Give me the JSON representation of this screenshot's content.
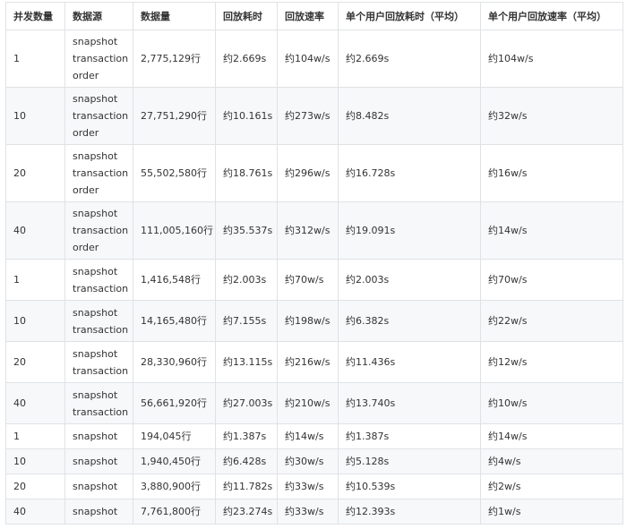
{
  "table": {
    "headers": [
      "并发数量",
      "数据源",
      "数据量",
      "回放耗时",
      "回放速率",
      "单个用户回放耗时（平均）",
      "单个用户回放速率（平均）"
    ],
    "rows": [
      {
        "concurrency": "1",
        "source": [
          "snapshot",
          "transaction",
          "order"
        ],
        "volume": "2,775,129行",
        "time": "约2.669s",
        "rate": "约104w/s",
        "user_time": "约2.669s",
        "user_rate": "约104w/s"
      },
      {
        "concurrency": "10",
        "source": [
          "snapshot",
          "transaction",
          "order"
        ],
        "volume": "27,751,290行",
        "time": "约10.161s",
        "rate": "约273w/s",
        "user_time": "约8.482s",
        "user_rate": "约32w/s"
      },
      {
        "concurrency": "20",
        "source": [
          "snapshot",
          "transaction",
          "order"
        ],
        "volume": "55,502,580行",
        "time": "约18.761s",
        "rate": "约296w/s",
        "user_time": "约16.728s",
        "user_rate": "约16w/s"
      },
      {
        "concurrency": "40",
        "source": [
          "snapshot",
          "transaction",
          "order"
        ],
        "volume": "111,005,160行",
        "time": "约35.537s",
        "rate": "约312w/s",
        "user_time": "约19.091s",
        "user_rate": "约14w/s"
      },
      {
        "concurrency": "1",
        "source": [
          "snapshot",
          "transaction"
        ],
        "volume": "1,416,548行",
        "time": "约2.003s",
        "rate": "约70w/s",
        "user_time": "约2.003s",
        "user_rate": "约70w/s"
      },
      {
        "concurrency": "10",
        "source": [
          "snapshot",
          "transaction"
        ],
        "volume": "14,165,480行",
        "time": "约7.155s",
        "rate": "约198w/s",
        "user_time": "约6.382s",
        "user_rate": "约22w/s"
      },
      {
        "concurrency": "20",
        "source": [
          "snapshot",
          "transaction"
        ],
        "volume": "28,330,960行",
        "time": "约13.115s",
        "rate": "约216w/s",
        "user_time": "约11.436s",
        "user_rate": "约12w/s"
      },
      {
        "concurrency": "40",
        "source": [
          "snapshot",
          "transaction"
        ],
        "volume": "56,661,920行",
        "time": "约27.003s",
        "rate": "约210w/s",
        "user_time": "约13.740s",
        "user_rate": "约10w/s"
      },
      {
        "concurrency": "1",
        "source": [
          "snapshot"
        ],
        "volume": "194,045行",
        "time": "约1.387s",
        "rate": "约14w/s",
        "user_time": "约1.387s",
        "user_rate": "约14w/s"
      },
      {
        "concurrency": "10",
        "source": [
          "snapshot"
        ],
        "volume": "1,940,450行",
        "time": "约6.428s",
        "rate": "约30w/s",
        "user_time": "约5.128s",
        "user_rate": "约4w/s"
      },
      {
        "concurrency": "20",
        "source": [
          "snapshot"
        ],
        "volume": "3,880,900行",
        "time": "约11.782s",
        "rate": "约33w/s",
        "user_time": "约10.539s",
        "user_rate": "约2w/s"
      },
      {
        "concurrency": "40",
        "source": [
          "snapshot"
        ],
        "volume": "7,761,800行",
        "time": "约23.274s",
        "rate": "约33w/s",
        "user_time": "约12.393s",
        "user_rate": "约1w/s"
      }
    ]
  }
}
